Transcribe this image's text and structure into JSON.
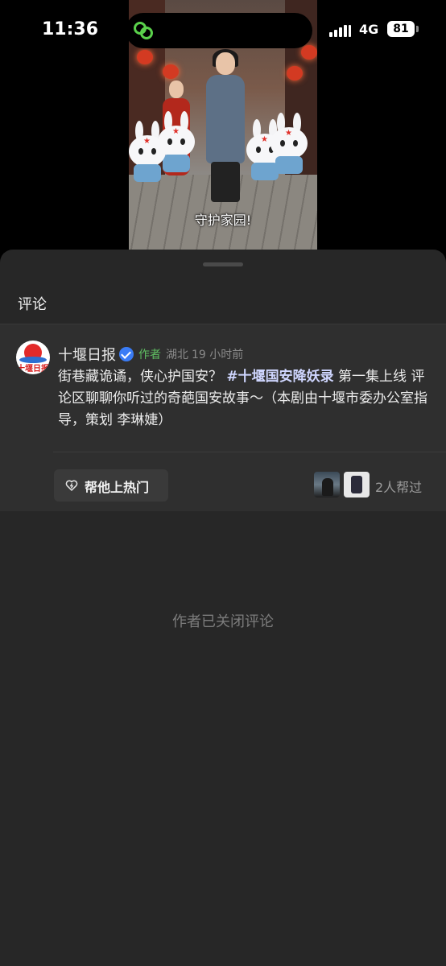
{
  "status_bar": {
    "time": "11:36",
    "network": "4G",
    "battery": "81"
  },
  "video": {
    "subtitle": "守护家园!"
  },
  "comments": {
    "title": "评论",
    "author_post": {
      "author": "十堰日报",
      "author_tag": "作者",
      "location": "湖北",
      "time_ago": "19 小时前",
      "text_before": "街巷藏诡谲，侠心护国安？ ",
      "hashtag": "#十堰国安降妖录",
      "text_after": " 第一集上线 评论区聊聊你听过的奇葩国安故事～（本剧由十堰市委办公室指导，策划 李琳婕）",
      "avatar_logo": "十堰日报",
      "boost_button": "帮他上热门",
      "helped_count": "2人帮过"
    },
    "closed_message": "作者已关闭评论"
  },
  "colors": {
    "sheet_bg": "#272727",
    "card_bg": "#2f2f2f",
    "author_tag": "#5fbf62",
    "verify_badge": "#3a7cf6"
  }
}
